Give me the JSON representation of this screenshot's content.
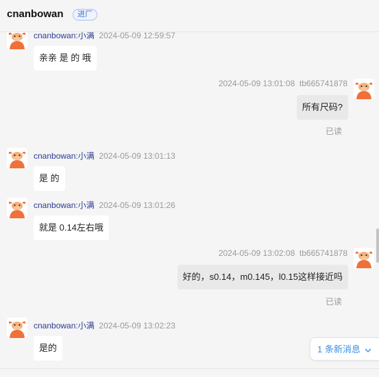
{
  "header": {
    "title": "cnanbowan",
    "badge": "进厂"
  },
  "messages": [
    {
      "nick": "cnanbowan:小满",
      "time": "2024-05-09 12:59:57",
      "text": "亲亲   是 的 哦"
    },
    {
      "time": "2024-05-09 13:01:08",
      "nick": "tb665741878",
      "text": "所有尺码?",
      "status": "已读"
    },
    {
      "nick": "cnanbowan:小满",
      "time": "2024-05-09 13:01:13",
      "text": "是 的"
    },
    {
      "nick": "cnanbowan:小满",
      "time": "2024-05-09 13:01:26",
      "text": "就是 0.14左右哦"
    },
    {
      "time": "2024-05-09 13:02:08",
      "nick": "tb665741878",
      "text": "好的，s0.14，m0.145，l0.15这样接近吗",
      "status": "已读"
    },
    {
      "nick": "cnanbowan:小满",
      "time": "2024-05-09 13:02:23",
      "text": "是的"
    }
  ],
  "new_messages": {
    "label": "1 条新消息"
  },
  "colors": {
    "nickname": "#2c3a8f",
    "new_message_link": "#3a8ee6",
    "avatar": "#f0703a"
  },
  "icons": [
    "bull-avatar-icon",
    "chevron-down-icon"
  ]
}
